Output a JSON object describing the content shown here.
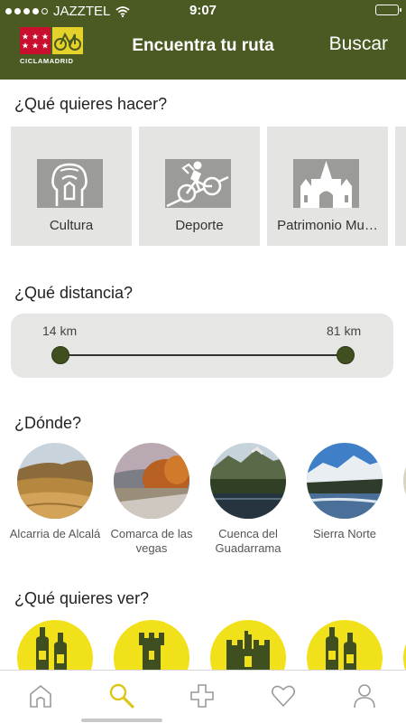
{
  "status_bar": {
    "carrier": "JAZZTEL",
    "time": "9:07",
    "signal_bars_filled": 4,
    "signal_bars_total": 5
  },
  "nav": {
    "logo_text": "CICLAMADRID",
    "title": "Encuentra tu ruta",
    "search_label": "Buscar"
  },
  "activity": {
    "title": "¿Qué quieres hacer?",
    "options": [
      {
        "label": "Cultura",
        "icon": "cultura-icon"
      },
      {
        "label": "Deporte",
        "icon": "cyclist-icon"
      },
      {
        "label": "Patrimonio Mu…",
        "icon": "monument-icon"
      }
    ]
  },
  "distance": {
    "title": "¿Qué distancia?",
    "min_label": "14 km",
    "max_label": "81 km"
  },
  "where": {
    "title": "¿Dónde?",
    "places": [
      {
        "name": "Alcarria de Alcalá"
      },
      {
        "name": "Comarca de las vegas"
      },
      {
        "name": "Cuenca del Guadarrama"
      },
      {
        "name": "Sierra Norte"
      }
    ]
  },
  "see": {
    "title": "¿Qué quieres ver?",
    "items": [
      "wine-bottles-icon",
      "castle-tower-icon",
      "castle-icon",
      "wine-bottles-icon"
    ]
  },
  "tabs": [
    {
      "name": "home",
      "icon": "home-icon",
      "active": false
    },
    {
      "name": "search",
      "icon": "search-icon",
      "active": true
    },
    {
      "name": "add",
      "icon": "plus-icon",
      "active": false
    },
    {
      "name": "favorites",
      "icon": "heart-icon",
      "active": false
    },
    {
      "name": "profile",
      "icon": "user-icon",
      "active": false
    }
  ],
  "colors": {
    "brand_green": "#4a5a22",
    "accent_yellow": "#f0e11a",
    "card_gray": "#e4e4e2",
    "thumb_green": "#3f4f1f"
  }
}
